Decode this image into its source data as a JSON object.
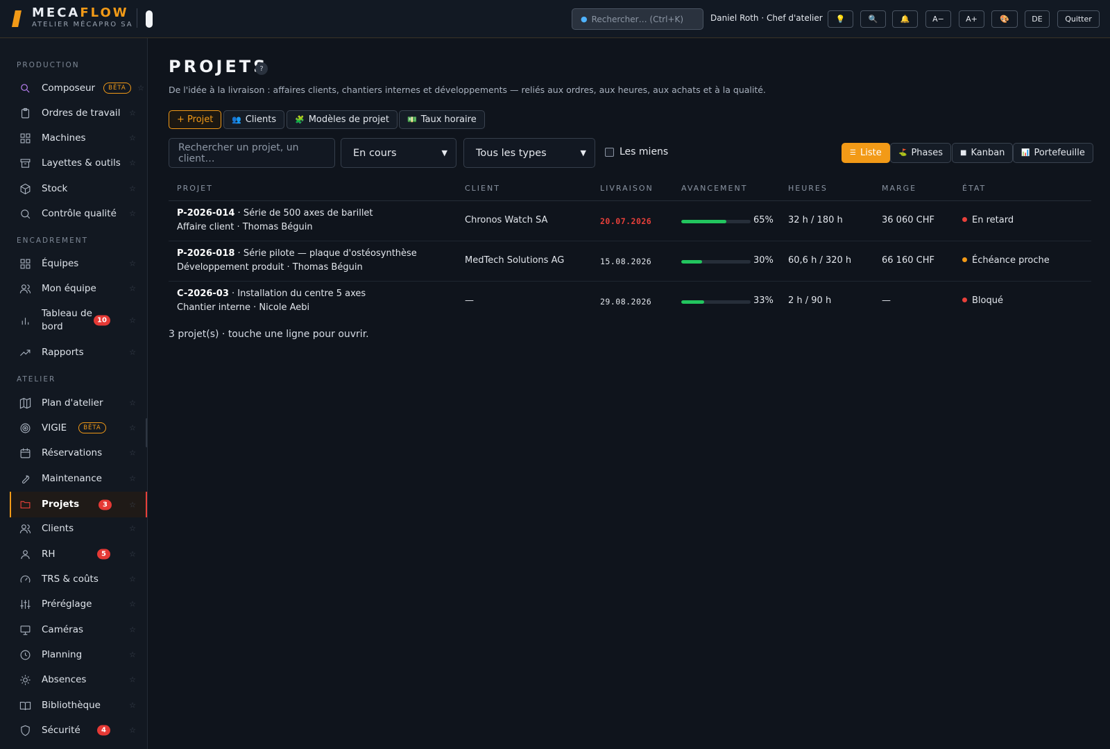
{
  "header": {
    "brand_part1": "MECA",
    "brand_part2": "FLOW",
    "company": "ATELIER MÉCAPRO SA",
    "search_placeholder": "Rechercher…  (Ctrl+K)",
    "user": "Daniel Roth · Chef d'atelier",
    "buttons": {
      "tips": "💡",
      "search": "🔍",
      "notifications": "🔔",
      "font_smaller": "A−",
      "font_larger": "A+",
      "theme": "🎨",
      "language": "DE",
      "quit": "Quitter"
    }
  },
  "sidebar": {
    "sections": [
      "PRODUCTION",
      "ENCADREMENT",
      "ATELIER"
    ],
    "items": [
      {
        "label": "Composeur",
        "icon": "magic-search-icon",
        "badge_beta": "BÊTA"
      },
      {
        "label": "Ordres de travail",
        "icon": "clipboard-icon"
      },
      {
        "label": "Machines",
        "icon": "grid-icon"
      },
      {
        "label": "Layettes & outils",
        "icon": "archive-icon"
      },
      {
        "label": "Stock",
        "icon": "box-icon"
      },
      {
        "label": "Contrôle qualité",
        "icon": "search-icon"
      },
      {
        "label": "Équipes",
        "icon": "grid-icon"
      },
      {
        "label": "Mon équipe",
        "icon": "users-icon"
      },
      {
        "label": "Tableau de bord",
        "icon": "bar-chart-icon",
        "count": "10"
      },
      {
        "label": "Rapports",
        "icon": "trending-up-icon"
      },
      {
        "label": "Plan d'atelier",
        "icon": "map-icon"
      },
      {
        "label": "VIGIE",
        "icon": "target-icon",
        "badge_beta": "BÊTA"
      },
      {
        "label": "Réservations",
        "icon": "calendar-icon"
      },
      {
        "label": "Maintenance",
        "icon": "wrench-icon"
      },
      {
        "label": "Projets",
        "icon": "folder-icon",
        "count": "3"
      },
      {
        "label": "Clients",
        "icon": "users-icon"
      },
      {
        "label": "RH",
        "icon": "user-icon",
        "count": "5"
      },
      {
        "label": "TRS & coûts",
        "icon": "gauge-icon"
      },
      {
        "label": "Préréglage",
        "icon": "sliders-icon"
      },
      {
        "label": "Caméras",
        "icon": "monitor-icon"
      },
      {
        "label": "Planning",
        "icon": "clock-icon"
      },
      {
        "label": "Absences",
        "icon": "sun-icon"
      },
      {
        "label": "Bibliothèque",
        "icon": "book-icon"
      },
      {
        "label": "Sécurité",
        "icon": "shield-icon",
        "count": "4"
      }
    ],
    "star": "☆"
  },
  "page": {
    "title": "PROJETS",
    "help": "?",
    "subtitle": "De l'idée à la livraison : affaires clients, chantiers internes et développements — reliés aux ordres, aux heures, aux achats et à la qualité.",
    "actions": {
      "new_project": "+ Projet",
      "clients": "Clients",
      "templates": "Modèles de projet",
      "rates": "Taux horaire"
    },
    "filters": {
      "search_placeholder": "Rechercher un projet, un client…",
      "status": "En cours",
      "type": "Tous les types",
      "mine": "Les miens"
    },
    "views": {
      "list": "Liste",
      "phases": "Phases",
      "kanban": "Kanban",
      "portfolio": "Portefeuille"
    },
    "columns": [
      "PROJET",
      "CLIENT",
      "LIVRAISON",
      "AVANCEMENT",
      "HEURES",
      "MARGE",
      "ÉTAT"
    ],
    "rows": [
      {
        "code": "P-2026-014",
        "title": " · Série de 500 axes de barillet",
        "sub": "Affaire client · Thomas Béguin",
        "client": "Chronos Watch SA",
        "delivery": "20.07.2026",
        "progress": 65,
        "progress_label": "65%",
        "hours": "32 h / 180 h",
        "margin": "36 060 CHF",
        "status": "En retard",
        "status_color": "#e8403a"
      },
      {
        "code": "P-2026-018",
        "title": " · Série pilote — plaque d'ostéosynthèse",
        "sub": "Développement produit · Thomas Béguin",
        "client": "MedTech Solutions AG",
        "delivery": "15.08.2026",
        "progress": 30,
        "progress_label": "30%",
        "hours": "60,6 h / 320 h",
        "margin": "66 160 CHF",
        "status": "Échéance proche",
        "status_color": "#f29a17"
      },
      {
        "code": "C-2026-03",
        "title": " · Installation du centre 5 axes",
        "sub": "Chantier interne · Nicole Aebi",
        "client": "—",
        "delivery": "29.08.2026",
        "progress": 33,
        "progress_label": "33%",
        "hours": "2 h / 90 h",
        "margin": "—",
        "status": "Bloqué",
        "status_color": "#e8403a"
      }
    ],
    "footer": "3 projet(s) · touche une ligne pour ouvrir."
  },
  "colors": {
    "accent": "#f29a17",
    "danger": "#e8403a",
    "progress": "#22c55e",
    "background": "#0f141c"
  }
}
